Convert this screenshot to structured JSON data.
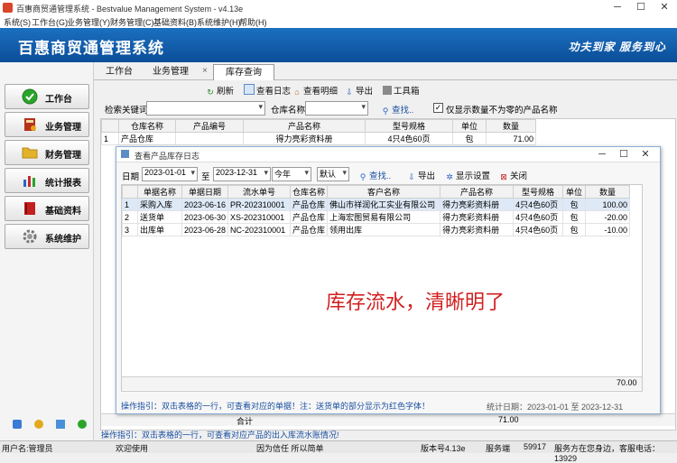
{
  "window": {
    "title": "百惠商贸通管理系统 - Bestvalue Management System - v4.13e",
    "minimize": "─",
    "maximize": "☐",
    "close": "✕"
  },
  "menu": [
    "系统(S)",
    "工作台(G)",
    "业务管理(Y)",
    "财务管理(C)",
    "基础资料(B)",
    "系统维护(H)",
    "帮助(H)"
  ],
  "banner": {
    "title": "百惠商贸通管理系统",
    "slogan": "功夫到家 服务到心"
  },
  "nav": [
    {
      "label": "工作台",
      "icon": "check-circle-icon",
      "color": "#2aa52a"
    },
    {
      "label": "业务管理",
      "icon": "book-icon",
      "color": "#b5321c"
    },
    {
      "label": "财务管理",
      "icon": "folder-icon",
      "color": "#e3b12b"
    },
    {
      "label": "统计报表",
      "icon": "bar-chart-icon",
      "color": "#2b66c4"
    },
    {
      "label": "基础资料",
      "icon": "book-red-icon",
      "color": "#c41f1f"
    },
    {
      "label": "系统维护",
      "icon": "gear-icon",
      "color": "#777777"
    }
  ],
  "tabs": {
    "t1": "工作台",
    "t2": "业务管理",
    "t3": "库存查询",
    "close": "×"
  },
  "toolbar": {
    "refresh": "刷新",
    "viewlog": "查看日志",
    "viewdetail": "查看明细",
    "export": "导出",
    "tools": "工具箱"
  },
  "search": {
    "keyword_label": "检索关键词",
    "keyword_value": "",
    "warehouse_label": "仓库名称",
    "warehouse_value": "",
    "query": "查找..",
    "checkbox_label": "仅显示数量不为零的产品名称",
    "checkbox_checked": true
  },
  "main_table": {
    "columns": [
      "仓库名称",
      "产品编号",
      "产品名称",
      "型号规格",
      "单位",
      "数量"
    ],
    "rows": [
      {
        "idx": "1",
        "warehouse": "产品仓库",
        "code": "",
        "name": "得力亮彩资料册",
        "spec": "4只4色60页",
        "unit": "包",
        "qty": "71.00"
      }
    ],
    "total_label": "合计",
    "total_qty": "71.00"
  },
  "tip_main": "操作指引：双击表格的一行，可查看对应产品的出入库流水账情况!",
  "dialog": {
    "title": "查看产品库存日志",
    "date_label": "日期",
    "date_from": "2023-01-01",
    "to": "至",
    "date_to": "2023-12-31",
    "period": "今年",
    "sort": "默认",
    "query": "查找..",
    "export": "导出",
    "display_settings": "显示设置",
    "close_btn": "关闭",
    "columns": [
      "单据名称",
      "单据日期",
      "流水单号",
      "仓库名称",
      "客户名称",
      "产品名称",
      "型号规格",
      "单位",
      "数量"
    ],
    "rows": [
      {
        "idx": "1",
        "doc": "采购入库",
        "date": "2023-06-16",
        "no": "PR-202310001",
        "wh": "产品仓库",
        "cust": "佛山市祥润化工实业有限公司",
        "prod": "得力亮彩资料册",
        "spec": "4只4色60页",
        "unit": "包",
        "qty": "100.00"
      },
      {
        "idx": "2",
        "doc": "送货单",
        "date": "2023-06-30",
        "no": "XS-202310001",
        "wh": "产品仓库",
        "cust": "上海宏图贸易有限公司",
        "prod": "得力亮彩资料册",
        "spec": "4只4色60页",
        "unit": "包",
        "qty": "-20.00"
      },
      {
        "idx": "3",
        "doc": "出库单",
        "date": "2023-06-28",
        "no": "NC-202310001",
        "wh": "产品仓库",
        "cust": "领用出库",
        "prod": "得力亮彩资料册",
        "spec": "4只4色60页",
        "unit": "包",
        "qty": "-10.00"
      }
    ],
    "total_qty": "70.00",
    "overlay_text": "库存流水，清晰明了",
    "tip": "操作指引：双击表格的一行，可查看对应的单据！注：送货单的部分显示为红色字体！",
    "stat": "统计日期：2023-01-01 至 2023-12-31"
  },
  "status": {
    "user": "用户名:管理员",
    "welcome": "欢迎使用",
    "motto": "因为信任 所以简单",
    "version": "版本号4.13e",
    "service": "服务端",
    "port": "59917",
    "hotline": "服务方在您身边，客服电话：13929"
  }
}
